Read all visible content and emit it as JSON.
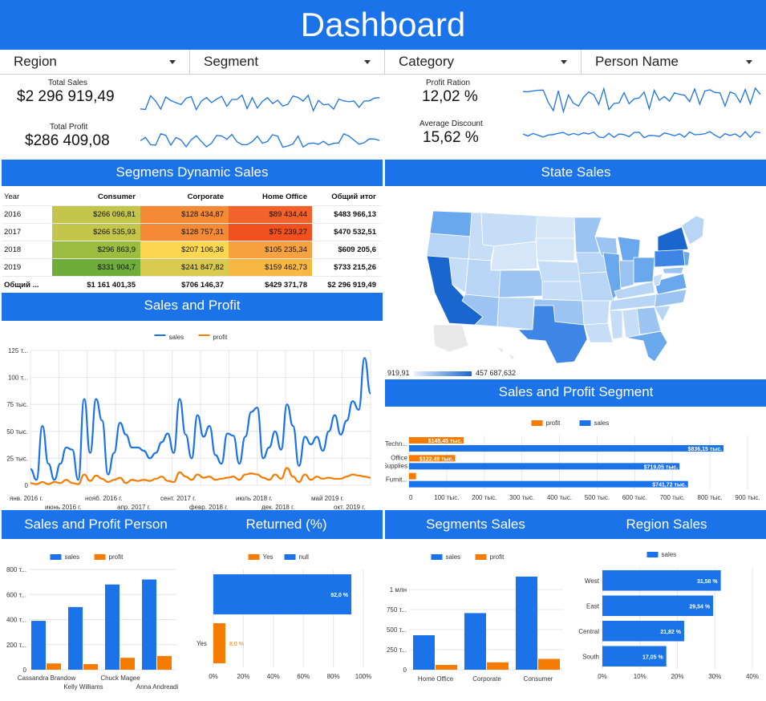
{
  "header": {
    "title": "Dashboard"
  },
  "filters": [
    "Region",
    "Segment",
    "Category",
    "Person Name"
  ],
  "kpis": {
    "total_sales_label": "Total Sales",
    "total_sales_value": "$2 296 919,49",
    "total_profit_label": "Total Profit",
    "total_profit_value": "$286 409,08",
    "profit_ratio_label": "Profit Ration",
    "profit_ratio_value": "12,02 %",
    "avg_discount_label": "Average Discount",
    "avg_discount_value": "15,62 %"
  },
  "sections": {
    "segments_dynamic": "Segmens Dynamic Sales",
    "state_sales": "State Sales",
    "sales_profit": "Sales and Profit",
    "sales_profit_segment": "Sales and Profit Segment",
    "sales_profit_person": "Sales and Profit Person",
    "returned": "Returned (%)",
    "segments_sales": "Segments Sales",
    "region_sales": "Region Sales"
  },
  "pivot": {
    "headers": [
      "Year",
      "Consumer",
      "Corporate",
      "Home Office",
      "Общий итог"
    ],
    "rows": [
      [
        "2016",
        "$266 096,81",
        "$128 434,87",
        "$89 434,44",
        "$483 966,13"
      ],
      [
        "2017",
        "$266 535,93",
        "$128 757,31",
        "$75 239,27",
        "$470 532,51"
      ],
      [
        "2018",
        "$296 863,9",
        "$207 106,36",
        "$105 235,34",
        "$609 205,6"
      ],
      [
        "2019",
        "$331 904,7",
        "$241 847,82",
        "$159 462,73",
        "$733 215,26"
      ]
    ],
    "grand": [
      "Общий ...",
      "$1 161 401,35",
      "$706 146,37",
      "$429 371,78",
      "$2 296 919,49"
    ],
    "cell_colors": [
      [
        "#c3c64a",
        "#f58a36",
        "#f4622c"
      ],
      [
        "#c3c64a",
        "#f58a36",
        "#f2501f"
      ],
      [
        "#9bbc3e",
        "#fbd64e",
        "#f7a240"
      ],
      [
        "#6fad3a",
        "#d7ca4e",
        "#f9b842"
      ]
    ]
  },
  "map": {
    "legend_min": "919,91",
    "legend_max": "457 687,632"
  },
  "colors": {
    "blue": "#1a73e8",
    "orange": "#f57c00",
    "header": "#1a73e8"
  },
  "chart_data": [
    {
      "id": "sales_profit_line",
      "type": "line",
      "legend": [
        "sales",
        "profit"
      ],
      "ylabels": [
        "125 т...",
        "100 т...",
        "75 тыс.",
        "50 тыс.",
        "25 тыс.",
        "0"
      ],
      "xlabels_top": [
        "янв. 2016 г.",
        "нояб. 2016 г.",
        "сент. 2017 г.",
        "июль 2018 г.",
        "май 2019 г."
      ],
      "xlabels_bottom": [
        "июнь 2016 г.",
        "апр. 2017 г.",
        "февр. 2018 г.",
        "дек. 2018 г.",
        "окт. 2019 г."
      ],
      "ylim": [
        0,
        125000
      ],
      "series": [
        {
          "name": "sales",
          "values": [
            15000,
            5000,
            55000,
            20000,
            5000,
            20000,
            35000,
            33000,
            5000,
            80000,
            30000,
            80000,
            60000,
            10000,
            30000,
            58000,
            47000,
            35000,
            35000,
            32000,
            25000,
            30000,
            40000,
            48000,
            30000,
            80000,
            47000,
            25000,
            65000,
            45000,
            55000,
            28000,
            20000,
            48000,
            46000,
            20000,
            45000,
            68000,
            72000,
            25000,
            35000,
            50000,
            33000,
            75000,
            55000,
            18000,
            45000,
            38000,
            45000,
            32000,
            50000,
            65000,
            47000,
            60000,
            78000,
            70000,
            118000,
            85000
          ]
        },
        {
          "name": "profit",
          "values": [
            2000,
            1000,
            3000,
            1000,
            3000,
            2000,
            5000,
            2000,
            1000,
            10000,
            4000,
            9000,
            6000,
            3000,
            5000,
            7000,
            2000,
            5000,
            4000,
            5000,
            4000,
            6000,
            8000,
            4000,
            3000,
            12000,
            8000,
            5000,
            10000,
            7000,
            8000,
            5000,
            6000,
            7000,
            8000,
            5000,
            10000,
            11000,
            10000,
            7000,
            5000,
            10000,
            6000,
            16000,
            8000,
            3000,
            10000,
            5000,
            8000,
            6000,
            7000,
            6000,
            6000,
            8000,
            10000,
            9000,
            8000,
            7000
          ]
        }
      ]
    },
    {
      "id": "sales_profit_segment",
      "type": "bar",
      "orientation": "horizontal",
      "legend": [
        "profit",
        "sales"
      ],
      "categories": [
        "Techn...",
        "Office Supplies",
        "Furnit..."
      ],
      "series": [
        {
          "name": "profit",
          "values": [
            145450,
            122490,
            18450
          ],
          "labels": [
            "$145,45 тыс.",
            "$122,49 тыс.",
            ""
          ]
        },
        {
          "name": "sales",
          "values": [
            836150,
            719050,
            741720
          ],
          "labels": [
            "$836,15 тыс.",
            "$719,05 тыс.",
            "$741,72 тыс."
          ]
        }
      ],
      "xticks": [
        "0",
        "100 тыс.",
        "200 тыс.",
        "300 тыс.",
        "400 тыс.",
        "500 тыс.",
        "600 тыс.",
        "700 тыс.",
        "800 тыс.",
        "900 тыс."
      ],
      "xlim": [
        0,
        900000
      ]
    },
    {
      "id": "sales_profit_person",
      "type": "bar",
      "legend": [
        "sales",
        "profit"
      ],
      "categories": [
        "Cassandra Brandow",
        "Kelly Williams",
        "Chuck Magee",
        "Anna Andreadi"
      ],
      "series": [
        {
          "name": "sales",
          "values": [
            390000,
            500000,
            680000,
            720000
          ]
        },
        {
          "name": "profit",
          "values": [
            50000,
            45000,
            95000,
            110000
          ]
        }
      ],
      "yticks": [
        "0",
        "200 т...",
        "400 т...",
        "600 т...",
        "800 т..."
      ],
      "ylim": [
        0,
        800000
      ]
    },
    {
      "id": "returned",
      "type": "bar",
      "orientation": "horizontal",
      "legend": [
        "Yes",
        "null"
      ],
      "categories": [
        "null",
        "Yes"
      ],
      "series": [
        {
          "name": "null",
          "values": [
            92.0
          ],
          "labels": [
            "92,0 %"
          ]
        },
        {
          "name": "Yes",
          "values": [
            8.0
          ],
          "labels": [
            "8,0 %"
          ]
        }
      ],
      "xticks": [
        "0%",
        "20%",
        "40%",
        "60%",
        "80%",
        "100%"
      ],
      "xlim": [
        0,
        100
      ],
      "ylabel_visible": [
        "",
        "Yes"
      ]
    },
    {
      "id": "segments_sales",
      "type": "bar",
      "legend": [
        "sales",
        "profit"
      ],
      "categories": [
        "Home Office",
        "Corporate",
        "Consumer"
      ],
      "series": [
        {
          "name": "sales",
          "values": [
            430000,
            706000,
            1161000
          ]
        },
        {
          "name": "profit",
          "values": [
            60000,
            92000,
            135000
          ]
        }
      ],
      "yticks": [
        "0",
        "250 т...",
        "500 т...",
        "750 т...",
        "1 млн"
      ],
      "ylim": [
        0,
        1250000
      ]
    },
    {
      "id": "region_sales",
      "type": "bar",
      "orientation": "horizontal",
      "legend": [
        "sales"
      ],
      "categories": [
        "West",
        "East",
        "Central",
        "South"
      ],
      "series": [
        {
          "name": "sales",
          "values": [
            31.58,
            29.54,
            21.82,
            17.05
          ],
          "labels": [
            "31,58 %",
            "29,54 %",
            "21,82 %",
            "17,05 %"
          ]
        }
      ],
      "xticks": [
        "0%",
        "10%",
        "20%",
        "30%",
        "40%"
      ],
      "xlim": [
        0,
        40
      ]
    }
  ]
}
